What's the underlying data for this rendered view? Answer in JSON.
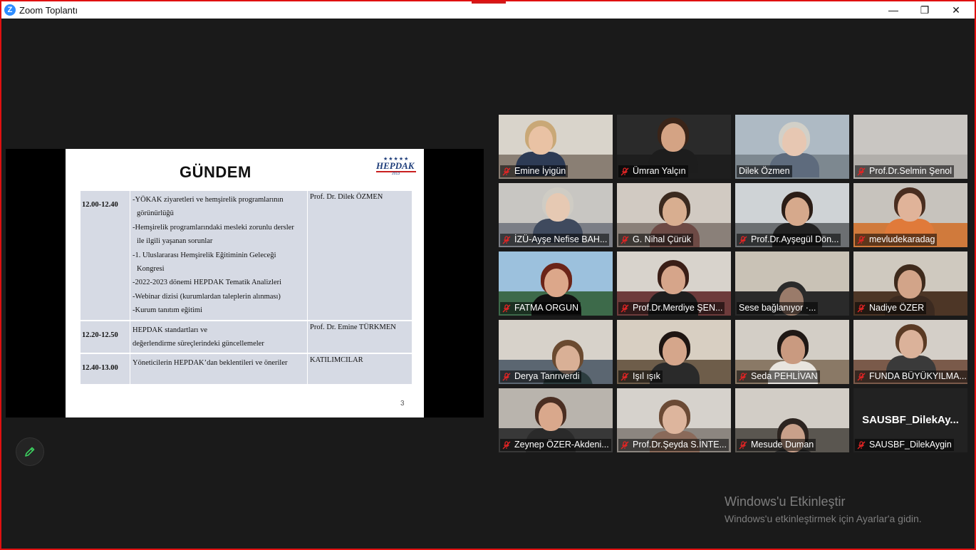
{
  "window": {
    "title": "Zoom Toplantı",
    "app_icon": "zoom-logo-icon",
    "min_glyph": "—",
    "restore_glyph": "❐",
    "close_glyph": "✕"
  },
  "slide": {
    "title": "GÜNDEM",
    "logo_text": "HEPDAK",
    "logo_year": "2013",
    "page_number": "3",
    "rows": [
      {
        "time": "12.00-12.40",
        "items": [
          "-YÖKAK ziyaretleri  ve hemşirelik programlarının",
          "görünürlüğü",
          "-Hemşirelik programlarındaki mesleki zorunlu dersler",
          "ile ilgili yaşanan sorunlar",
          "-1. Uluslararası Hemşirelik Eğitiminin Geleceği",
          "Kongresi",
          "-2022-2023  dönemi HEPDAK  Tematik Analizleri",
          "-Webinar dizisi  (kurumlardan taleplerin alınması)",
          "-Kurum tanıtım eğitimi"
        ],
        "speaker": "Prof. Dr. Dilek ÖZMEN"
      },
      {
        "time": "12.20-12.50",
        "items": [
          "HEPDAK  standartları ve",
          "değerlendirme süreçlerindeki güncellemeler"
        ],
        "speaker": "Prof. Dr. Emine TÜRKMEN"
      },
      {
        "time": "12.40-13.00",
        "items": [
          "Yöneticilerin HEPDAK’dan beklentileri ve öneriler"
        ],
        "speaker": " KATILIMCILAR"
      }
    ]
  },
  "annotate_button": {
    "icon": "pencil-icon",
    "color": "#3ccf5f"
  },
  "participants": [
    {
      "name": "Emine İyigün",
      "muted": true
    },
    {
      "name": "Ümran Yalçın",
      "muted": true
    },
    {
      "name": "Dilek Özmen",
      "muted": false,
      "active_speaker": true
    },
    {
      "name": "Prof.Dr.Selmin Şenol",
      "muted": true
    },
    {
      "name": "İZÜ-Ayşe Nefise BAH...",
      "muted": true
    },
    {
      "name": "G. Nihal Çürük",
      "muted": true
    },
    {
      "name": "Prof.Dr.Ayşegül Dön...",
      "muted": true
    },
    {
      "name": "mevludekaradag",
      "muted": true
    },
    {
      "name": "FATMA ORGUN",
      "muted": true
    },
    {
      "name": "Prof.Dr.Merdiye ŞEN...",
      "muted": true
    },
    {
      "name": "Sese bağlanıyor ·...",
      "muted": false
    },
    {
      "name": "Nadiye ÖZER",
      "muted": true
    },
    {
      "name": "Derya Tanrıverdi",
      "muted": true
    },
    {
      "name": "Işıl ışık",
      "muted": true
    },
    {
      "name": "Seda PEHLİVAN",
      "muted": true
    },
    {
      "name": "FUNDA BÜYÜKYILMA...",
      "muted": true
    },
    {
      "name": "Zeynep ÖZER-Akdeni...",
      "muted": true
    },
    {
      "name": "Prof.Dr.Şeyda S.İNTE...",
      "muted": true
    },
    {
      "name": "Mesude Duman",
      "muted": true
    },
    {
      "name": "SAUSBF_DilekAygin",
      "muted": true,
      "video_off": true,
      "display_name": "SAUSBF_DilekAy..."
    }
  ],
  "watermark": {
    "line1": "Windows'u Etkinleştir",
    "line2": "Windows'u etkinleştirmek için Ayarlar'a gidin."
  },
  "colors": {
    "active_speaker_border": "#d7e63b",
    "mute_icon": "#e02424",
    "border": "#e01010",
    "slide_table": "#d6dae4"
  }
}
